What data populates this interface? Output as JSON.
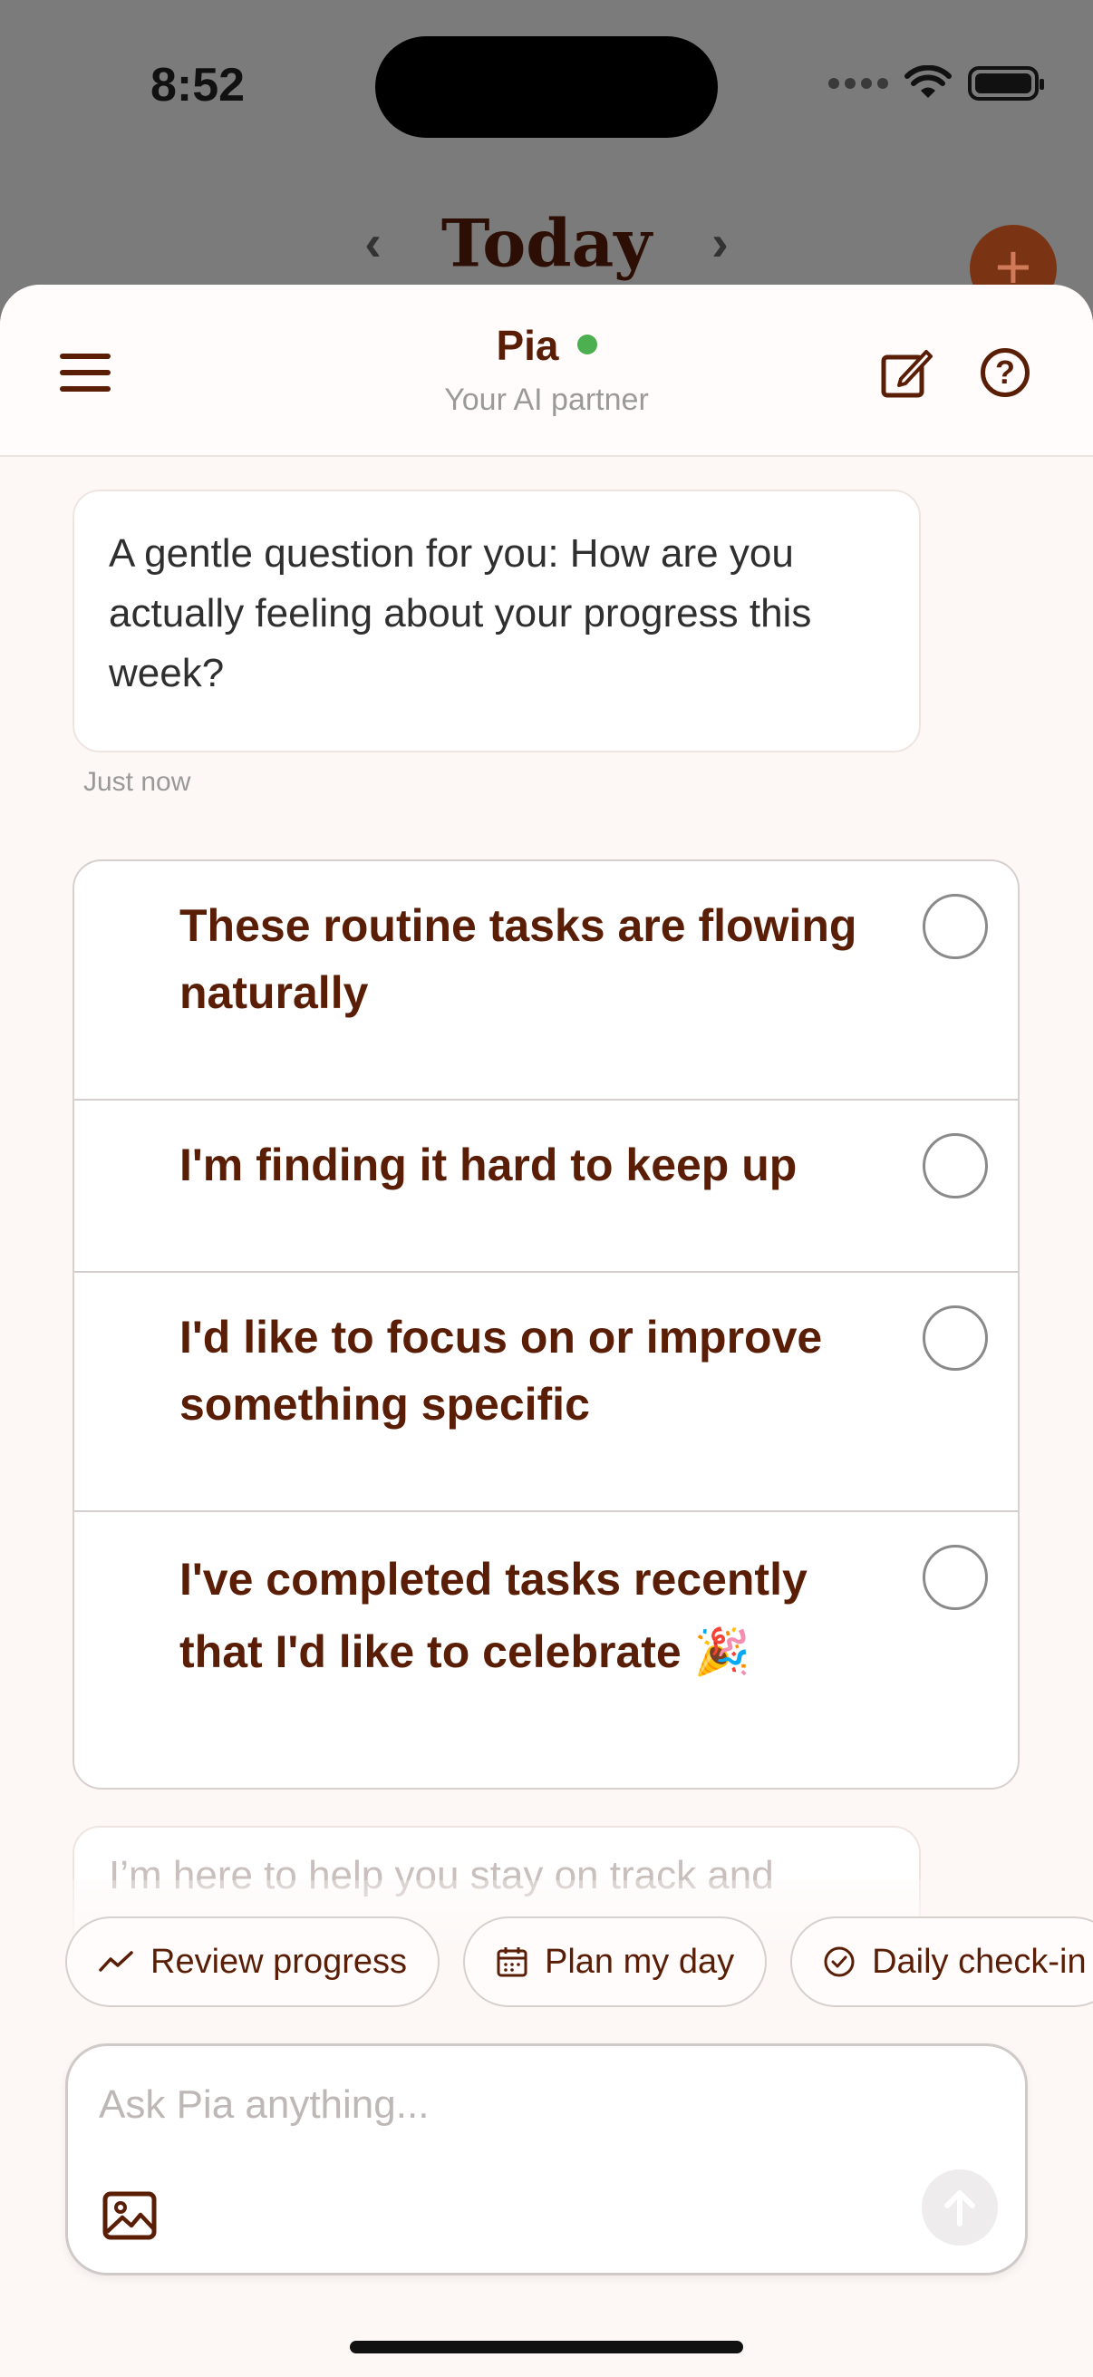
{
  "status_bar": {
    "time": "8:52"
  },
  "background": {
    "nav_title": "Today",
    "prev": "‹",
    "next": "›",
    "fab": "+"
  },
  "header": {
    "name": "Pia",
    "subtitle": "Your AI partner"
  },
  "messages": {
    "question": "A gentle question for you: How are you actually feeling about your progress this week?",
    "timestamp": "Just now",
    "next_preview": "I’m here to help you stay on track and"
  },
  "options": [
    {
      "label": "These routine tasks are flowing naturally",
      "selected": false
    },
    {
      "label": "I'm finding it hard to keep up",
      "selected": false
    },
    {
      "label": "I'd like to focus on or improve something specific",
      "selected": false
    },
    {
      "label": "I've completed tasks recently that I'd like to celebrate 🎉",
      "selected": false
    }
  ],
  "chips": [
    {
      "label": "Review progress",
      "icon": "trend-icon"
    },
    {
      "label": "Plan my day",
      "icon": "calendar-icon"
    },
    {
      "label": "Daily check-in",
      "icon": "check-circle-icon"
    }
  ],
  "composer": {
    "placeholder": "Ask Pia anything..."
  },
  "colors": {
    "accent": "#5a1e07",
    "online": "#4caf50",
    "sheet_bg": "#fdf8f6"
  }
}
